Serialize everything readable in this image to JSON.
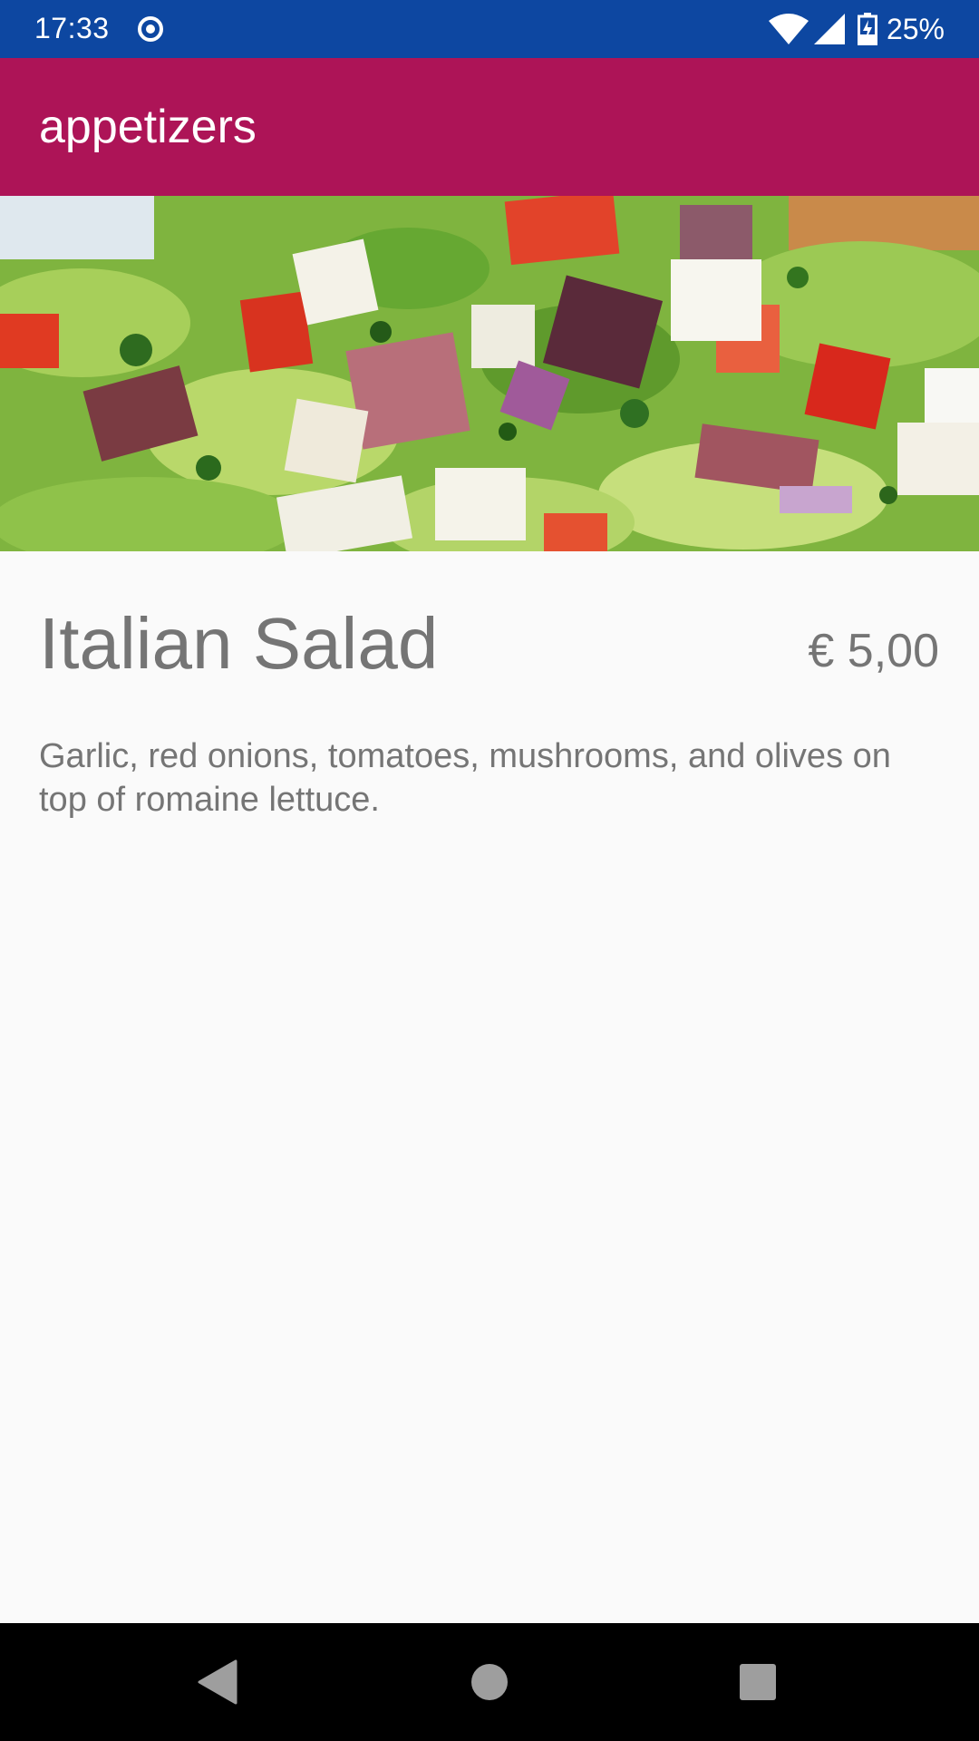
{
  "status_bar": {
    "time": "17:33",
    "battery": "25%",
    "icons": [
      "sync-icon",
      "wifi-icon",
      "cell-signal-icon",
      "battery-charging-icon"
    ],
    "background_color": "#0d47a1"
  },
  "app_bar": {
    "title": "appetizers",
    "background_color": "#ad1457"
  },
  "item": {
    "name": "Italian Salad",
    "price": "€ 5,00",
    "description": "Garlic, red onions, tomatoes, mushrooms, and olives on top of romaine lettuce.",
    "image": "salad-photo"
  },
  "nav_bar": {
    "buttons": [
      "back-icon",
      "home-icon",
      "recents-icon"
    ]
  }
}
